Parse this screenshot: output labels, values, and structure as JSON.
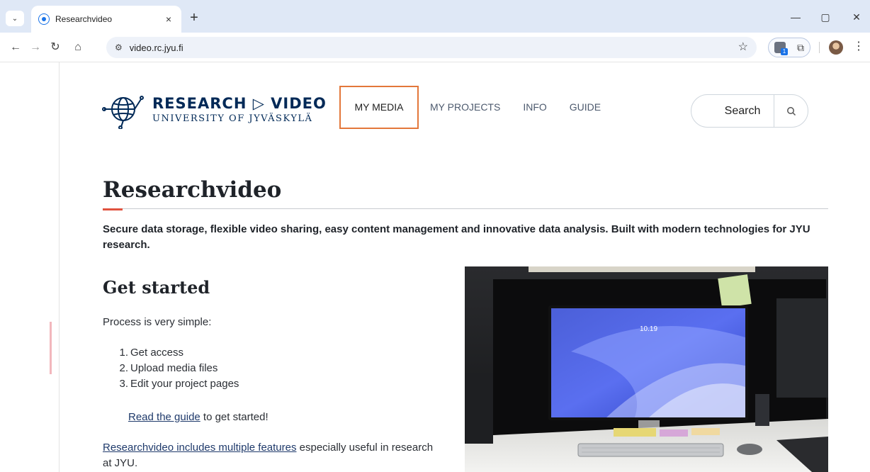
{
  "browser": {
    "tab_title": "Researchvideo",
    "tab_close": "×",
    "new_tab": "+",
    "url": "video.rc.jyu.fi",
    "extension_badge": "1",
    "window_controls": {
      "minimize": "—",
      "maximize": "▢",
      "close": "✕"
    }
  },
  "site": {
    "logo_main": "RESEARCH ▷ VIDEO",
    "logo_sub": "UNIVERSITY OF JYVÄSKYLÄ",
    "nav": [
      "MY MEDIA",
      "MY PROJECTS",
      "INFO",
      "GUIDE"
    ],
    "search_label": "Search"
  },
  "main": {
    "title": "Researchvideo",
    "lead": "Secure data storage, flexible video sharing, easy content management and innovative data analysis. Built with modern technologies for JYU research.",
    "get_started": "Get started",
    "intro": "Process is very simple:",
    "steps": [
      {
        "num": "1.",
        "text": "Get access"
      },
      {
        "num": "2.",
        "text": "Upload media files"
      },
      {
        "num": "3.",
        "text": "Edit your project pages"
      }
    ],
    "guide_link": "Read the guide",
    "guide_rest": " to get started!",
    "features_link": "Researchvideo includes multiple features",
    "features_rest": " especially useful in research at JYU.",
    "photo_clock": "10.19"
  },
  "colors": {
    "brand": "#002957",
    "active_nav_border": "#e3773a",
    "title_accent": "#e0533f"
  }
}
